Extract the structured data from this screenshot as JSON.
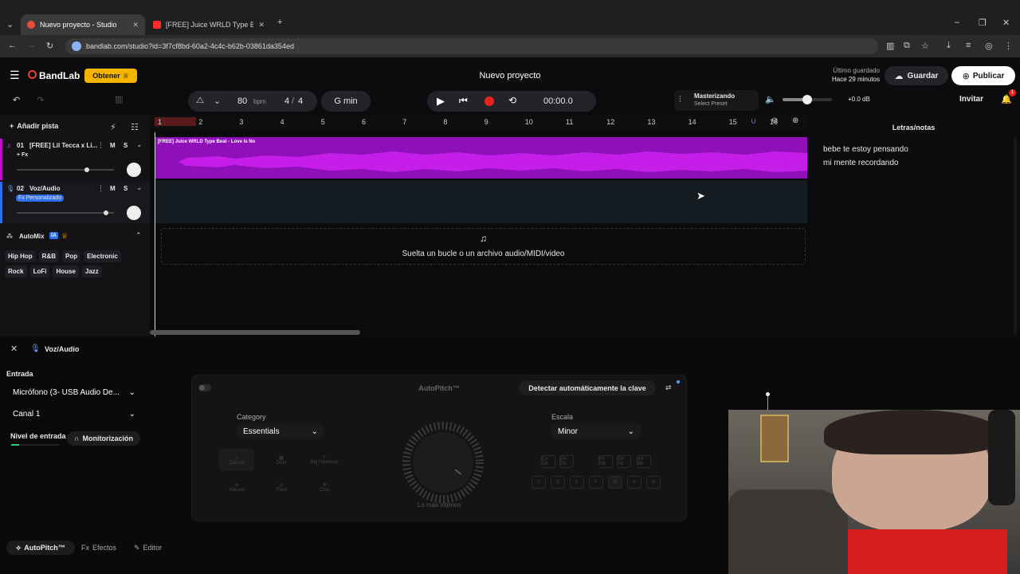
{
  "browser": {
    "tabs": [
      {
        "title": "Nuevo proyecto - Studio"
      },
      {
        "title": "[FREE] Juice WRLD Type Beat - \""
      }
    ],
    "url": "bandlab.com/studio?id=3f7cf8bd-60a2-4c4c-b62b-03861da354ed"
  },
  "app": {
    "brand": "BandLab",
    "get_button": "Obtener",
    "project_title": "Nuevo proyecto",
    "last_saved_label": "Último guardado",
    "last_saved_time": "Hace 29 minutos",
    "save_button": "Guardar",
    "publish_button": "Publicar",
    "invite_button": "Invitar",
    "notification_count": "1"
  },
  "transport": {
    "bpm_value": "80",
    "bpm_unit": "bpm",
    "time_sig_num": "4",
    "time_sig_sep": "/",
    "time_sig_den": "4",
    "key": "G min",
    "time": "00:00.0",
    "mastering_title": "Masterizando",
    "mastering_preset": "Select Preset",
    "volume_db": "+0.0 dB",
    "volume_level": 0.5
  },
  "tracks": {
    "add_track": "Añadir pista",
    "items": [
      {
        "number": "01",
        "name": "[FREE] Lil Tecca x Li...",
        "fx": "+ Fx",
        "mute": "M",
        "solo": "S",
        "volume": 0.72
      },
      {
        "number": "02",
        "name": "Voz/Audio",
        "fx": "Fx Personalizado",
        "mute": "M",
        "solo": "S",
        "volume": 0.92
      }
    ],
    "region_title": "[FREE] Juice WRLD Type Beat - Love Is No",
    "drop_hint": "Suelta un bucle o un archivo audio/MIDI/video"
  },
  "automix": {
    "title": "AutoMix",
    "badge": "IA",
    "genres": [
      "Hip Hop",
      "R&B",
      "Pop",
      "Electronic",
      "Rock",
      "LoFi",
      "House",
      "Jazz"
    ]
  },
  "ruler": [
    "1",
    "2",
    "3",
    "4",
    "5",
    "6",
    "7",
    "8",
    "9",
    "10",
    "11",
    "12",
    "13",
    "14",
    "15",
    "16"
  ],
  "lyrics": {
    "title": "Letras/notas",
    "lines": [
      "bebe te estoy pensando",
      "mi mente recordando"
    ]
  },
  "bottom_panel": {
    "track_name": "Voz/Audio",
    "input_label": "Entrada",
    "input_device": "Micrófono (3- USB Audio De...",
    "channel": "Canal 1",
    "input_level_label": "Nivel de entrada",
    "monitoring": "Monitorización",
    "tabs": [
      "AutoPitch™",
      "Efectos",
      "Editor"
    ]
  },
  "autopitch": {
    "title": "AutoPitch™",
    "detect_key": "Detectar automáticamente la clave",
    "category_label": "Category",
    "category_value": "Essentials",
    "voices": [
      "Classic",
      "Duet",
      "Big Harmony",
      "Natural",
      "Third",
      "Chip"
    ],
    "knob_label": "Lo más intenso",
    "scale_label": "Escala",
    "scale_value": "Minor",
    "keys_top": [
      "C#\nDb",
      "D#\nEb",
      "F#\nGb",
      "G#\nAb",
      "A#\nBb"
    ],
    "keys_bottom": [
      "C",
      "D",
      "E",
      "F",
      "G",
      "A",
      "B"
    ]
  }
}
